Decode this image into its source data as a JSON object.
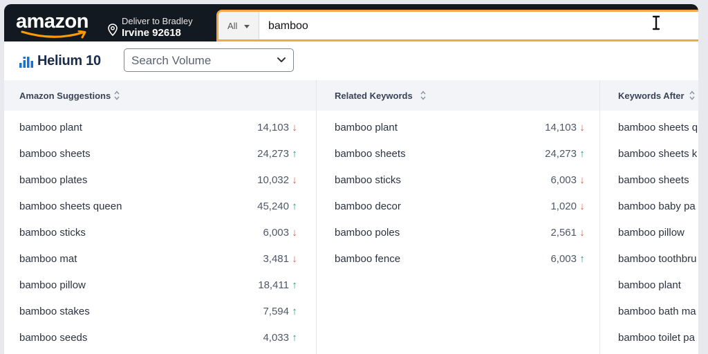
{
  "header": {
    "logo_text": "amazon",
    "deliver_line1": "Deliver to Bradley",
    "deliver_line2": "Irvine 92618",
    "search_category": "All",
    "search_value": "bamboo"
  },
  "helium": {
    "brand": "Helium 10",
    "metric_select": "Search Volume"
  },
  "colors": {
    "amazon_dark": "#131921",
    "search_border": "#f3a847",
    "trend_down": "#e05a47",
    "trend_up": "#23a07a"
  },
  "columns": [
    {
      "title": "Amazon Suggestions",
      "rows": [
        {
          "keyword": "bamboo plant",
          "volume": "14,103",
          "trend": "down"
        },
        {
          "keyword": "bamboo sheets",
          "volume": "24,273",
          "trend": "up"
        },
        {
          "keyword": "bamboo plates",
          "volume": "10,032",
          "trend": "down"
        },
        {
          "keyword": "bamboo sheets queen",
          "volume": "45,240",
          "trend": "up"
        },
        {
          "keyword": "bamboo sticks",
          "volume": "6,003",
          "trend": "down"
        },
        {
          "keyword": "bamboo mat",
          "volume": "3,481",
          "trend": "down"
        },
        {
          "keyword": "bamboo pillow",
          "volume": "18,411",
          "trend": "up"
        },
        {
          "keyword": "bamboo stakes",
          "volume": "7,594",
          "trend": "up"
        },
        {
          "keyword": "bamboo seeds",
          "volume": "4,033",
          "trend": "up"
        }
      ]
    },
    {
      "title": "Related Keywords",
      "rows": [
        {
          "keyword": "bamboo plant",
          "volume": "14,103",
          "trend": "down"
        },
        {
          "keyword": "bamboo sheets",
          "volume": "24,273",
          "trend": "up"
        },
        {
          "keyword": "bamboo sticks",
          "volume": "6,003",
          "trend": "down"
        },
        {
          "keyword": "bamboo decor",
          "volume": "1,020",
          "trend": "down"
        },
        {
          "keyword": "bamboo poles",
          "volume": "2,561",
          "trend": "down"
        },
        {
          "keyword": "bamboo fence",
          "volume": "6,003",
          "trend": "up"
        }
      ]
    },
    {
      "title": "Keywords After",
      "rows": [
        {
          "keyword": "bamboo sheets q",
          "volume": "",
          "trend": ""
        },
        {
          "keyword": "bamboo sheets k",
          "volume": "",
          "trend": ""
        },
        {
          "keyword": "bamboo sheets",
          "volume": "",
          "trend": ""
        },
        {
          "keyword": "bamboo baby pa",
          "volume": "",
          "trend": ""
        },
        {
          "keyword": "bamboo pillow",
          "volume": "",
          "trend": ""
        },
        {
          "keyword": "bamboo toothbru",
          "volume": "",
          "trend": ""
        },
        {
          "keyword": "bamboo plant",
          "volume": "",
          "trend": ""
        },
        {
          "keyword": "bamboo bath ma",
          "volume": "",
          "trend": ""
        },
        {
          "keyword": "bamboo toilet pa",
          "volume": "",
          "trend": ""
        }
      ]
    }
  ]
}
